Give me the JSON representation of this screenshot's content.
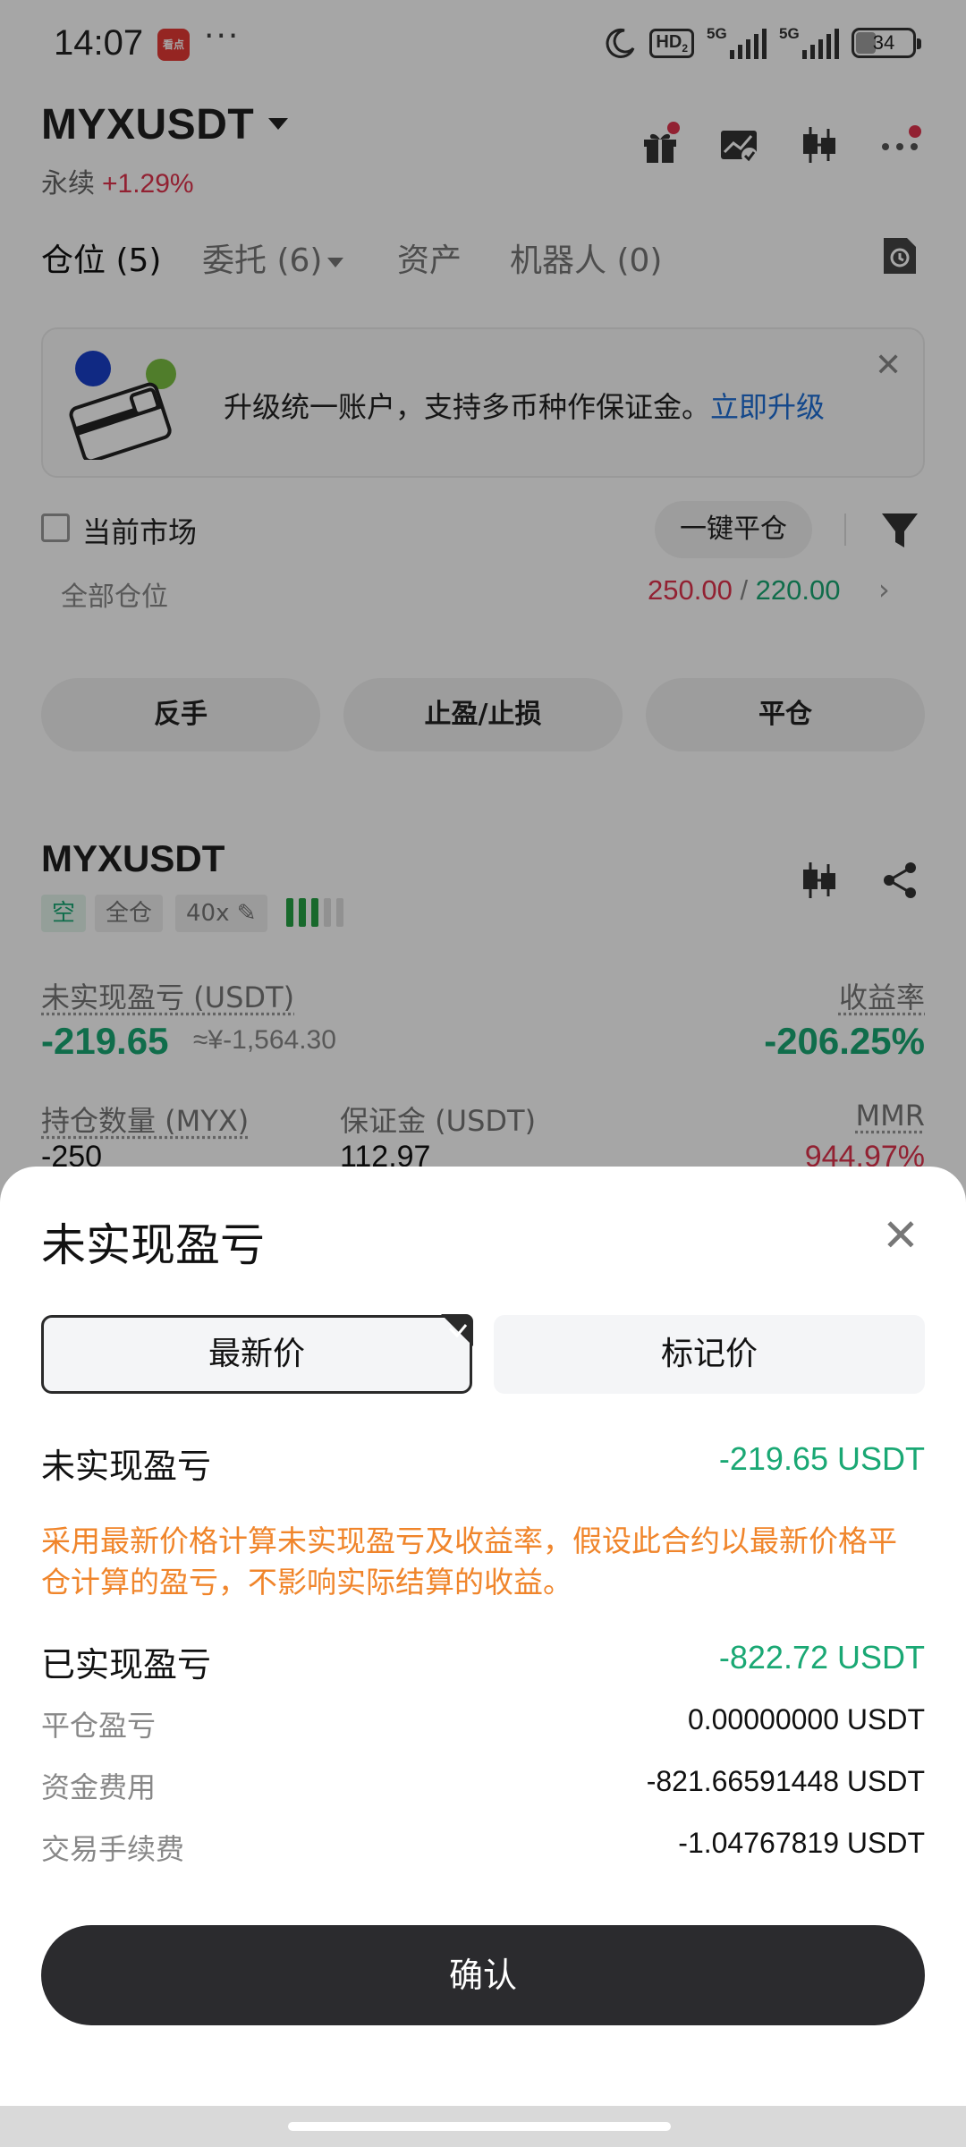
{
  "status_bar": {
    "time": "14:07",
    "app_icon_text": "看点",
    "more": "···",
    "hd": "HD",
    "sim1": "5G",
    "sim2": "5G",
    "battery": "34",
    "icons": [
      "moon-icon",
      "hd-voice-icon",
      "signal-icon",
      "battery-icon"
    ]
  },
  "header": {
    "symbol": "MYXUSDT",
    "contract_type": "永续",
    "change": "+1.29%",
    "icons": [
      "gift-icon",
      "chart-edit-icon",
      "candlestick-icon",
      "more-icon"
    ]
  },
  "tabs": [
    {
      "label": "仓位 (5)",
      "active": true
    },
    {
      "label": "委托 (6)",
      "active": false
    },
    {
      "label": "资产",
      "active": false
    },
    {
      "label": "机器人 (0)",
      "active": false
    }
  ],
  "banner": {
    "text": "升级统一账户，支持多币种作保证金。",
    "link": "立即升级"
  },
  "filters": {
    "current_market": "当前市场",
    "close_all": "一键平仓",
    "all_positions": "全部仓位",
    "value_red": "250.00",
    "separator": " / ",
    "value_green": "220.00"
  },
  "actions": [
    "反手",
    "止盈/止损",
    "平仓"
  ],
  "position": {
    "symbol": "MYXUSDT",
    "side": "空",
    "margin_mode": "全仓",
    "leverage": "40x",
    "unrealized_label": "未实现盈亏 (USDT)",
    "unrealized_value": "-219.65",
    "unrealized_cny": "≈¥-1,564.30",
    "roe_label": "收益率",
    "roe_value": "-206.25%",
    "qty_label": "持仓数量 (MYX)",
    "qty_value": "-250",
    "margin_label": "保证金 (USDT)",
    "margin_value": "112.97",
    "mmr_label": "MMR",
    "mmr_value": "944.97%"
  },
  "sheet": {
    "title": "未实现盈亏",
    "segments": [
      {
        "label": "最新价",
        "selected": true
      },
      {
        "label": "标记价",
        "selected": false
      }
    ],
    "unrealized_label": "未实现盈亏",
    "unrealized_value": "-219.65 USDT",
    "note": "采用最新价格计算未实现盈亏及收益率，假设此合约以最新价格平仓计算的盈亏，不影响实际结算的收益。",
    "realized_label": "已实现盈亏",
    "realized_value": "-822.72 USDT",
    "details": [
      {
        "label": "平仓盈亏",
        "value": "0.00000000 USDT"
      },
      {
        "label": "资金费用",
        "value": "-821.66591448 USDT"
      },
      {
        "label": "交易手续费",
        "value": "-1.04767819 USDT"
      }
    ],
    "confirm": "确认"
  },
  "colors": {
    "red": "#e0344d",
    "green": "#1aa874",
    "orange_note": "#f0852b",
    "link_blue": "#1f6fd6",
    "confirm_bg": "#2b2b2e"
  }
}
